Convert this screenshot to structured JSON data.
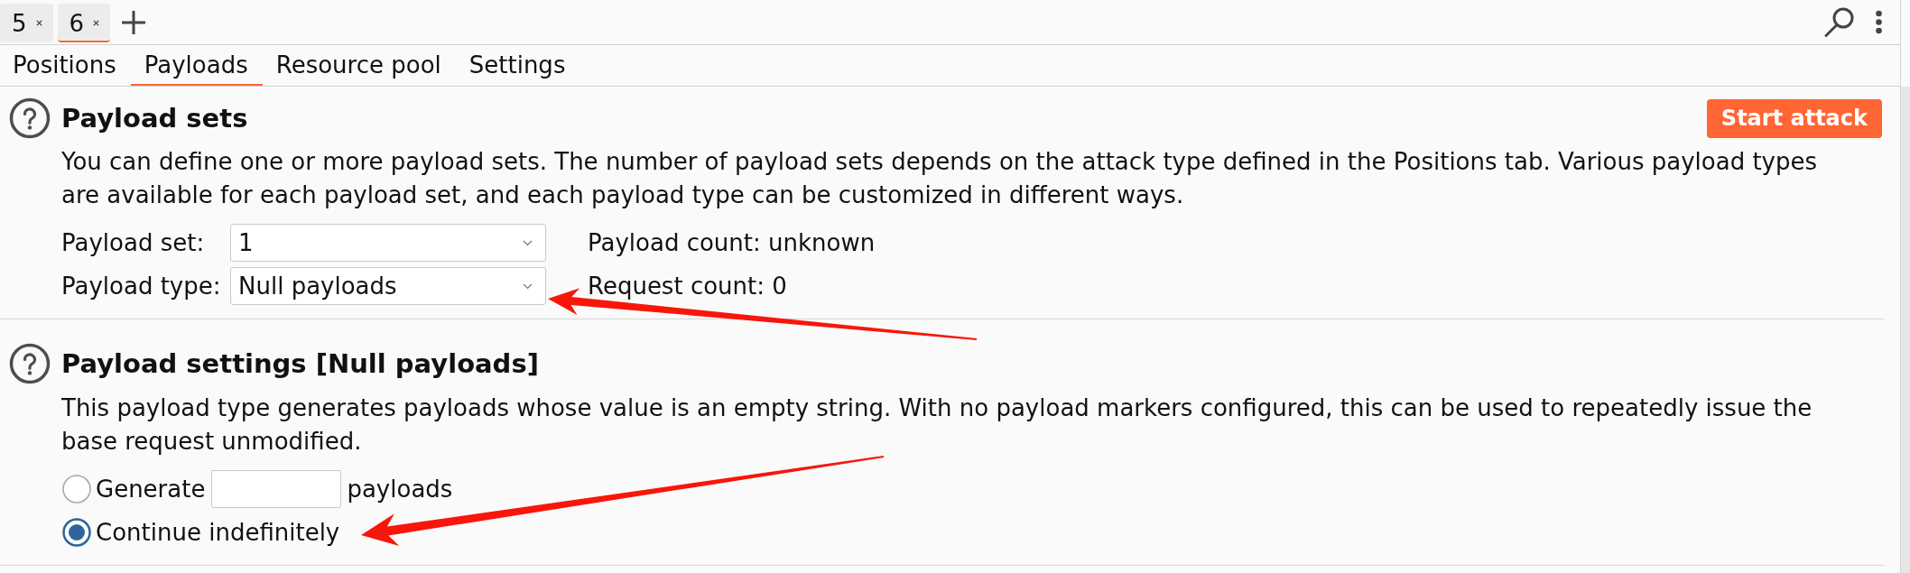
{
  "session_tabs": [
    {
      "label": "5",
      "selected": false
    },
    {
      "label": "6",
      "selected": true
    }
  ],
  "tool_tabs": [
    {
      "label": "Positions",
      "selected": false
    },
    {
      "label": "Payloads",
      "selected": true
    },
    {
      "label": "Resource pool",
      "selected": false
    },
    {
      "label": "Settings",
      "selected": false
    }
  ],
  "payload_sets": {
    "title": "Payload sets",
    "description": "You can define one or more payload sets. The number of payload sets depends on the attack type defined in the Positions tab. Various payload types are available for each payload set, and each payload type can be customized in different ways.",
    "action": "Start attack",
    "fields": [
      {
        "label": "Payload set:",
        "value": "1",
        "info": "Payload count: unknown"
      },
      {
        "label": "Payload type:",
        "value": "Null payloads",
        "info": "Request count: 0"
      }
    ]
  },
  "payload_settings": {
    "title": "Payload settings [Null payloads]",
    "description": "This payload type generates payloads whose value is an empty string. With no payload markers configured, this can be used to repeatedly issue the base request unmodified.",
    "options": [
      {
        "kind": "count",
        "label": "Generate",
        "suffix": "payloads",
        "selected": false
      },
      {
        "kind": "plain",
        "label": "Continue indefinitely",
        "selected": true
      }
    ]
  }
}
